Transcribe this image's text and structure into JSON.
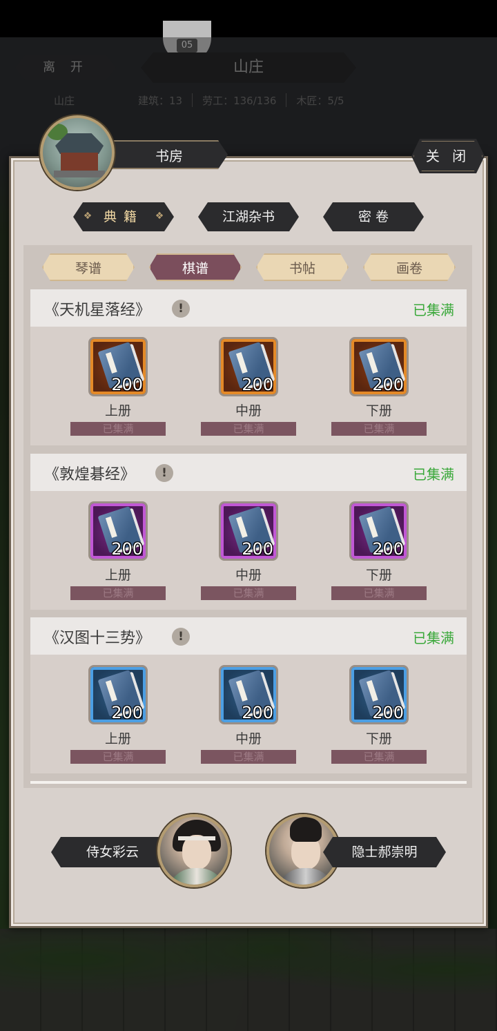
{
  "background": {
    "leave_label": "离 开",
    "title": "山庄",
    "top_badge": "05",
    "sub_name": "山庄",
    "stats": [
      "建筑：13",
      "劳工：136/136",
      "木匠：5/5"
    ]
  },
  "room": {
    "title": "书房",
    "close_label": "关 闭"
  },
  "category_tabs": [
    {
      "label": "典籍",
      "active": true
    },
    {
      "label": "江湖杂书",
      "active": false
    },
    {
      "label": "密 卷",
      "active": false
    }
  ],
  "sub_tabs": [
    {
      "label": "琴谱",
      "active": false
    },
    {
      "label": "棋谱",
      "active": true
    },
    {
      "label": "书帖",
      "active": false
    },
    {
      "label": "画卷",
      "active": false
    }
  ],
  "books": [
    {
      "name": "《天机星落经》",
      "status": "已集满",
      "quality": "orange",
      "volumes": [
        {
          "label": "上册",
          "count": "200",
          "state": "已集满"
        },
        {
          "label": "中册",
          "count": "200",
          "state": "已集满"
        },
        {
          "label": "下册",
          "count": "200",
          "state": "已集满"
        }
      ]
    },
    {
      "name": "《敦煌碁经》",
      "status": "已集满",
      "quality": "purple",
      "volumes": [
        {
          "label": "上册",
          "count": "200",
          "state": "已集满"
        },
        {
          "label": "中册",
          "count": "200",
          "state": "已集满"
        },
        {
          "label": "下册",
          "count": "200",
          "state": "已集满"
        }
      ]
    },
    {
      "name": "《汉图十三势》",
      "status": "已集满",
      "quality": "blue",
      "volumes": [
        {
          "label": "上册",
          "count": "200",
          "state": "已集满"
        },
        {
          "label": "中册",
          "count": "200",
          "state": "已集满"
        },
        {
          "label": "下册",
          "count": "200",
          "state": "已集满"
        }
      ]
    }
  ],
  "info_icon_glyph": "!",
  "characters": [
    {
      "name": "侍女彩云"
    },
    {
      "name": "隐士郝崇明"
    }
  ],
  "colors": {
    "status_green": "#3aa83a",
    "active_subtab": "#7b4e5c",
    "orange_frame": "#e48a28",
    "purple_frame": "#c158d5",
    "blue_frame": "#4c9fe4"
  }
}
